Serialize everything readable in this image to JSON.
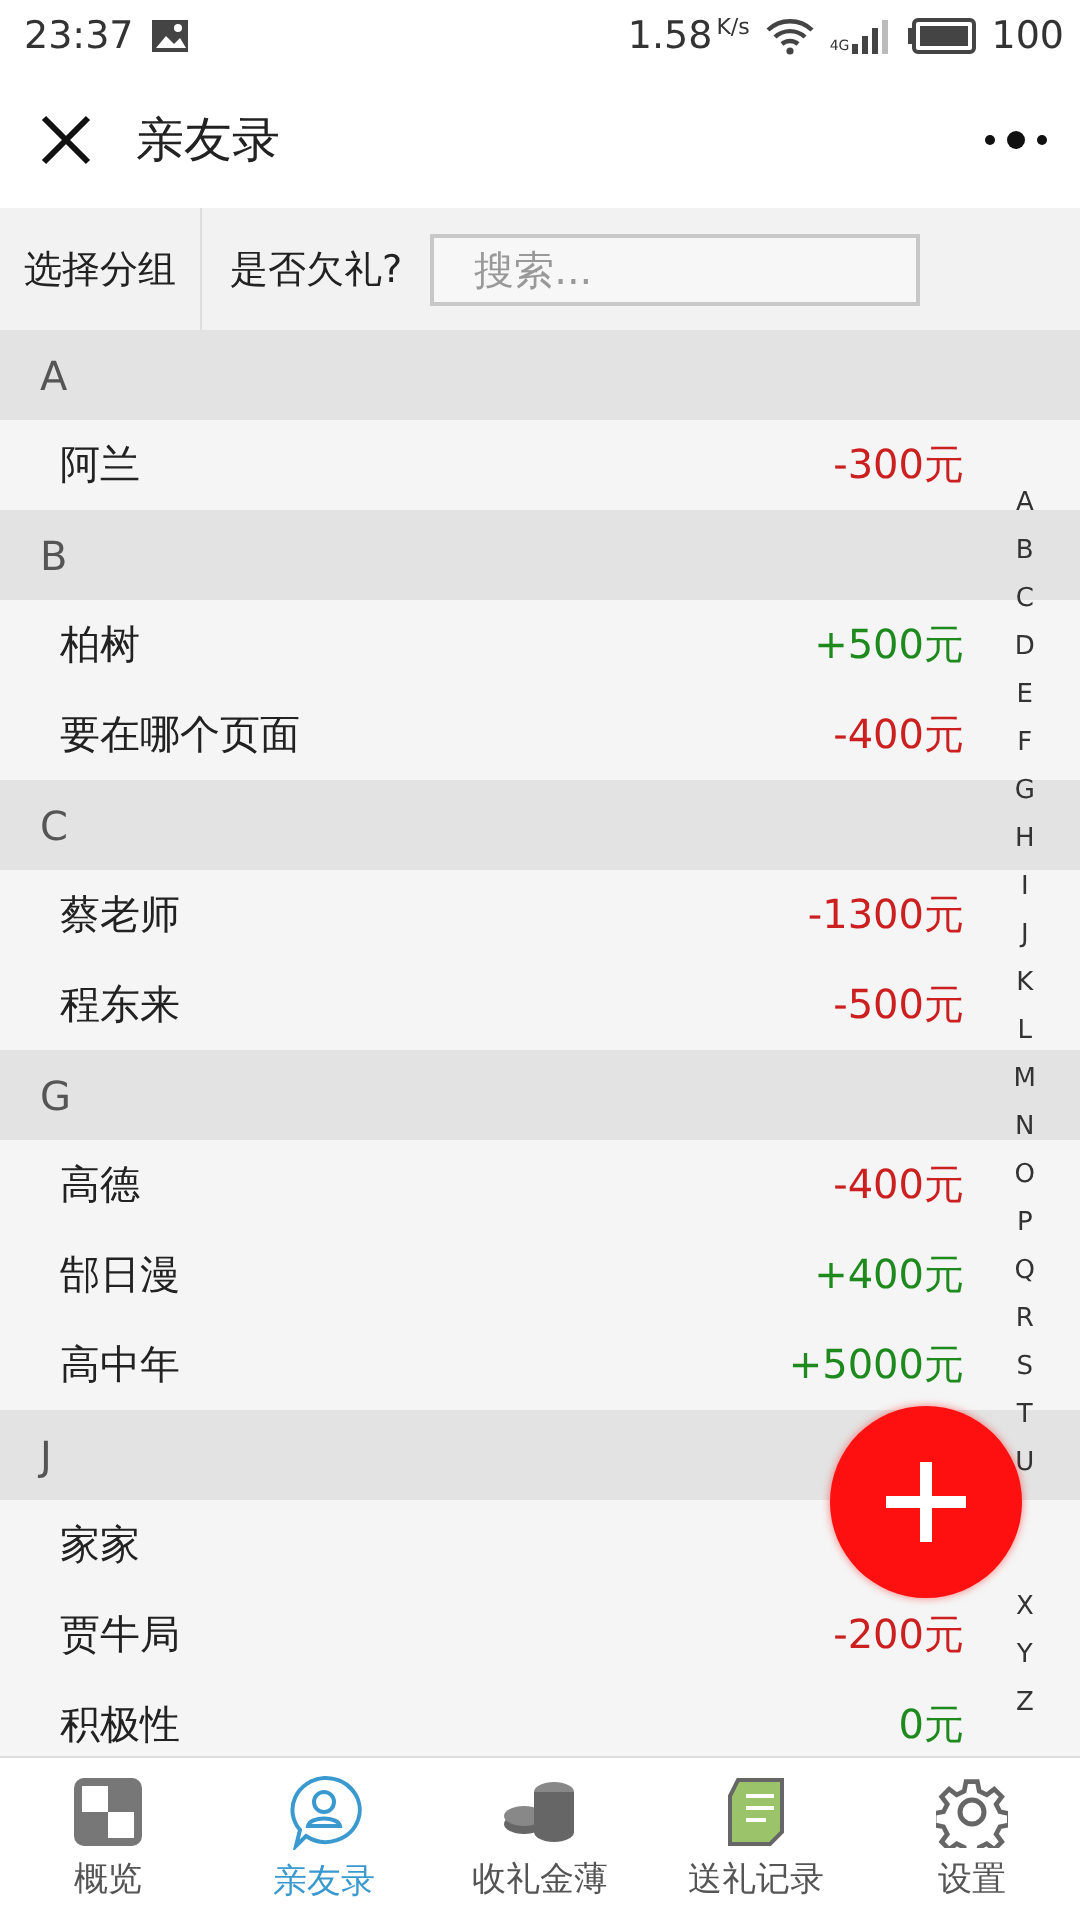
{
  "status_bar": {
    "time": "23:37",
    "speed": "1.58",
    "speed_unit": "K/s",
    "network": "4G",
    "battery": "100"
  },
  "header": {
    "title": "亲友录"
  },
  "filter_bar": {
    "group_label": "选择分组",
    "owed_label": "是否欠礼?",
    "search": {
      "placeholder": "搜索..."
    }
  },
  "sections": [
    {
      "letter": "A",
      "contacts": [
        {
          "name": "阿兰",
          "amount": "-300元",
          "color": "#cc2020"
        }
      ]
    },
    {
      "letter": "B",
      "contacts": [
        {
          "name": "柏树",
          "amount": "+500元",
          "color": "#1e8a1e"
        },
        {
          "name": "要在哪个页面",
          "amount": "-400元",
          "color": "#cc2020"
        }
      ]
    },
    {
      "letter": "C",
      "contacts": [
        {
          "name": "蔡老师",
          "amount": "-1300元",
          "color": "#cc2020"
        },
        {
          "name": "程东来",
          "amount": "-500元",
          "color": "#cc2020"
        }
      ]
    },
    {
      "letter": "G",
      "contacts": [
        {
          "name": "高德",
          "amount": "-400元",
          "color": "#cc2020"
        },
        {
          "name": "郜日漫",
          "amount": "+400元",
          "color": "#1e8a1e"
        },
        {
          "name": "高中年",
          "amount": "+5000元",
          "color": "#1e8a1e"
        }
      ]
    },
    {
      "letter": "J",
      "contacts": [
        {
          "name": "家家"
        },
        {
          "name": "贾牛局",
          "amount": "-200元",
          "color": "#cc2020"
        },
        {
          "name": "积极性",
          "amount": "0元",
          "color": "#1e8a1e"
        }
      ]
    }
  ],
  "index_top": [
    "A",
    "B",
    "C",
    "D",
    "E",
    "F",
    "G",
    "H",
    "I",
    "J",
    "K",
    "L",
    "M",
    "N",
    "O",
    "P",
    "Q",
    "R",
    "S",
    "T",
    "U"
  ],
  "index_bottom": [
    "X",
    "Y",
    "Z"
  ],
  "tabs": [
    {
      "label": "概览",
      "kind": "overview",
      "selected": false
    },
    {
      "label": "亲友录",
      "kind": "contacts",
      "selected": true
    },
    {
      "label": "收礼金薄",
      "kind": "coins",
      "selected": false
    },
    {
      "label": "送礼记录",
      "kind": "ledger",
      "selected": false
    },
    {
      "label": "设置",
      "kind": "settings",
      "selected": false
    }
  ]
}
